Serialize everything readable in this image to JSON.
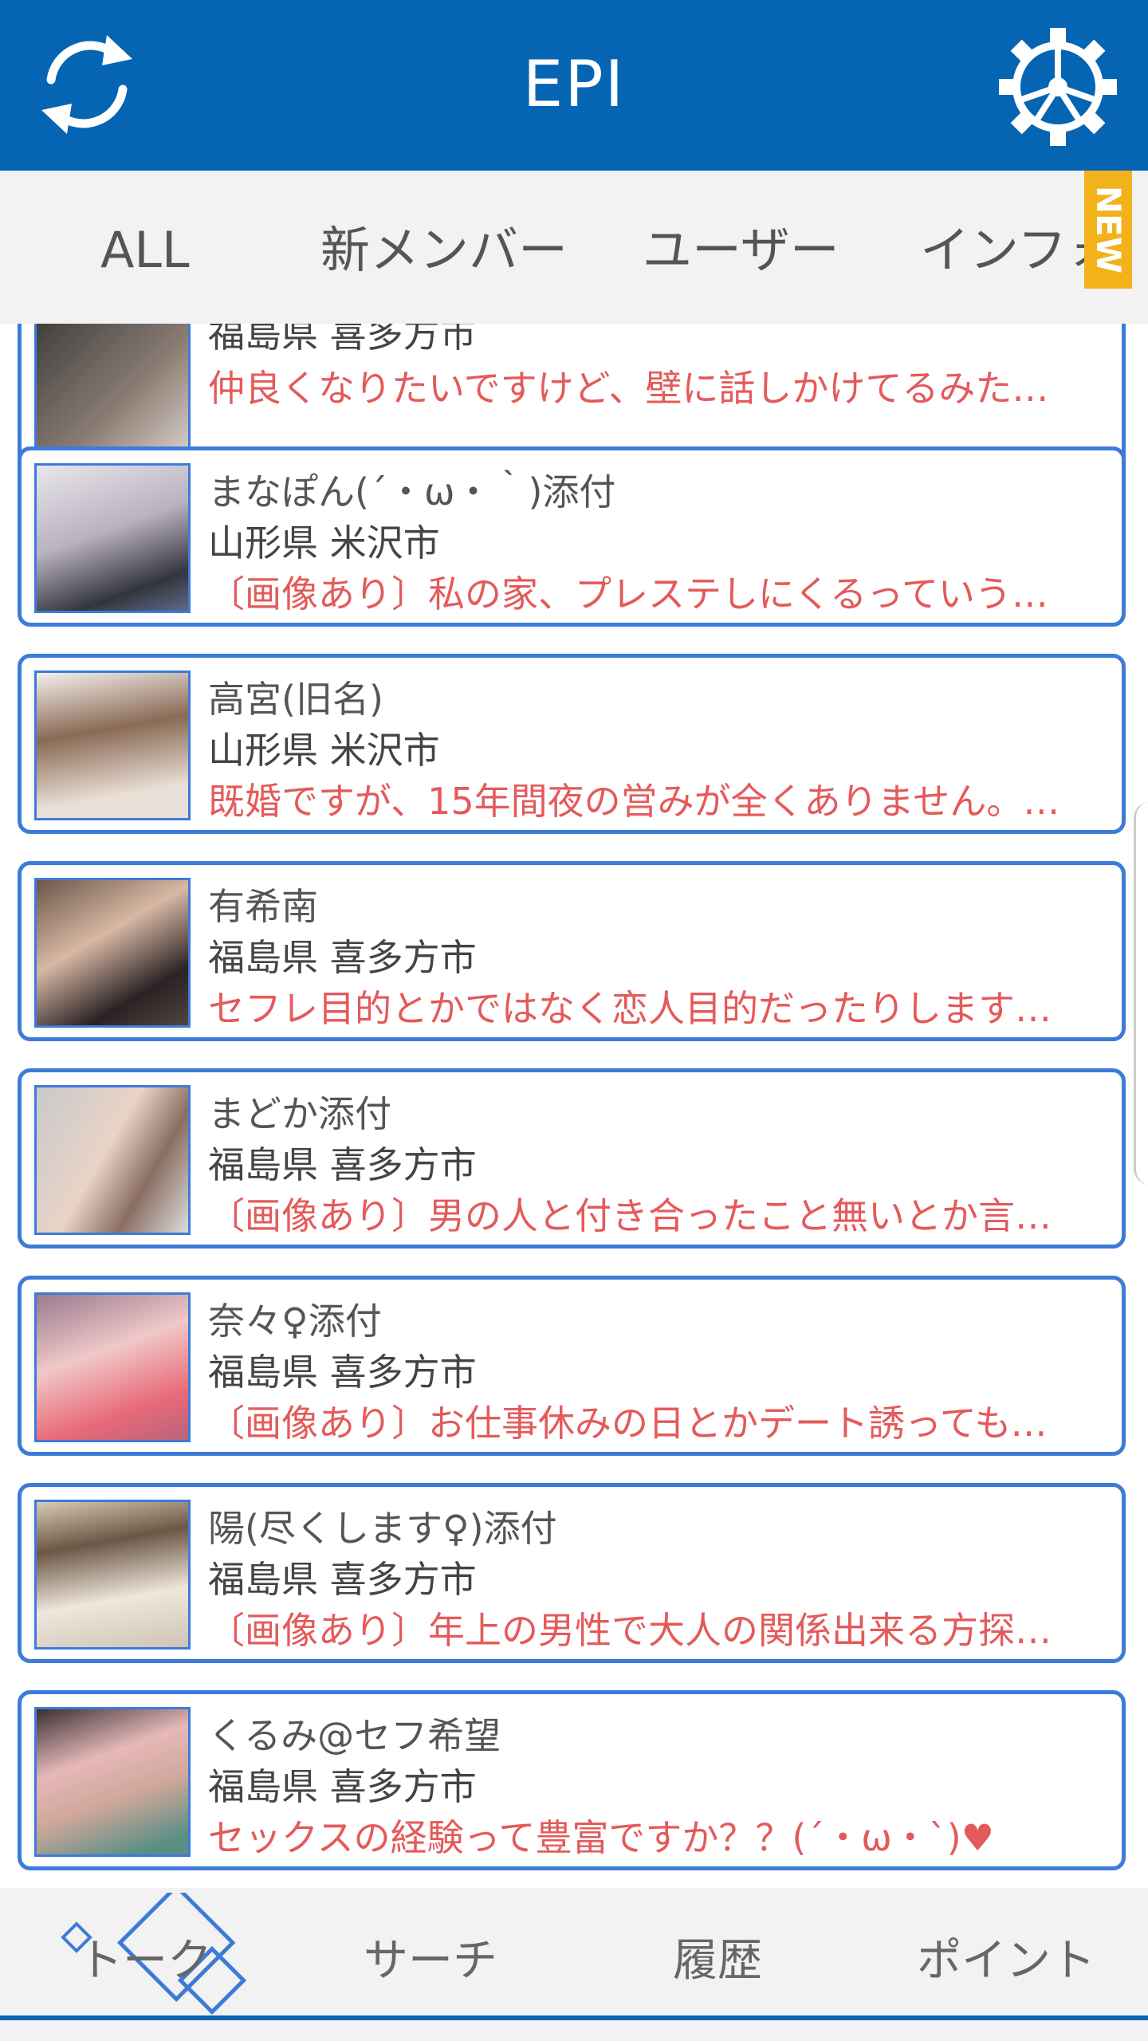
{
  "header": {
    "title": "EPI"
  },
  "tabs": [
    {
      "label": "ALL"
    },
    {
      "label": "新メンバー"
    },
    {
      "label": "ユーザー"
    },
    {
      "label": "インフォ"
    }
  ],
  "new_badge": "NEW",
  "cards": [
    {
      "name": "",
      "location": "福島県 喜多方市",
      "message": "仲良くなりたいですけど、壁に話しかけてるみたい..."
    },
    {
      "name": "まなぽん(´・ω・｀)添付",
      "location": "山形県 米沢市",
      "message": "〔画像あり〕私の家、プレステしにくるっていうテ..."
    },
    {
      "name": "高宮(旧名)",
      "location": "山形県 米沢市",
      "message": "既婚ですが、15年間夜の営みが全くありません。正..."
    },
    {
      "name": "有希南",
      "location": "福島県 喜多方市",
      "message": "セフレ目的とかではなく恋人目的だったりしますか..."
    },
    {
      "name": "まどか添付",
      "location": "福島県 喜多方市",
      "message": "〔画像あり〕男の人と付き合ったこと無いとか言っ..."
    },
    {
      "name": "奈々♀添付",
      "location": "福島県 喜多方市",
      "message": "〔画像あり〕お仕事休みの日とかデート誘ってもい..."
    },
    {
      "name": "陽(尽くします♀)添付",
      "location": "福島県 喜多方市",
      "message": "〔画像あり〕年上の男性で大人の関係出来る方探し..."
    },
    {
      "name": "くるみ@セフ希望",
      "location": "福島県 喜多方市",
      "message": "セックスの経験って豊富ですか？？(´・ω・`)♥"
    }
  ],
  "bottom_nav": [
    {
      "label": "トーク"
    },
    {
      "label": "サーチ"
    },
    {
      "label": "履歴"
    },
    {
      "label": "ポイント"
    }
  ],
  "colors": {
    "header_bg": "#0665B3",
    "card_border": "#3D7BD8",
    "message_text": "#E45A5A",
    "new_badge": "#F2B21A"
  },
  "icons": [
    "refresh-icon",
    "settings-gear-icon"
  ]
}
